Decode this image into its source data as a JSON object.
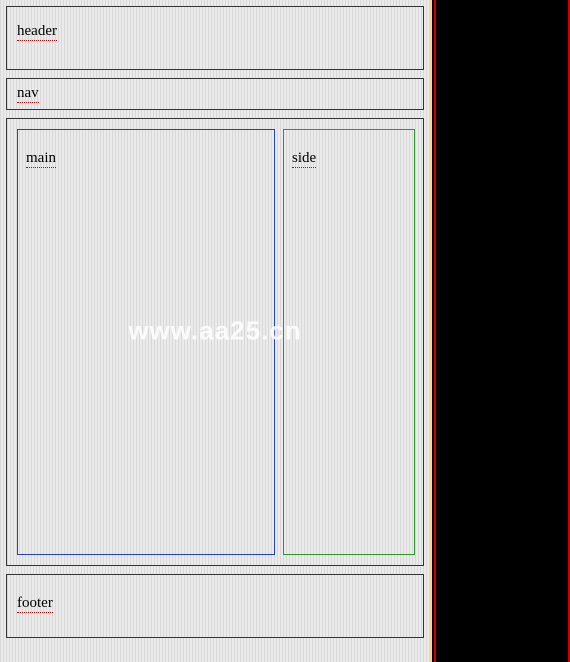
{
  "layout": {
    "header_label": "header",
    "nav_label": "nav",
    "main_label": "main",
    "side_label": "side",
    "footer_label": "footer"
  },
  "watermark": "www.aa25.cn"
}
